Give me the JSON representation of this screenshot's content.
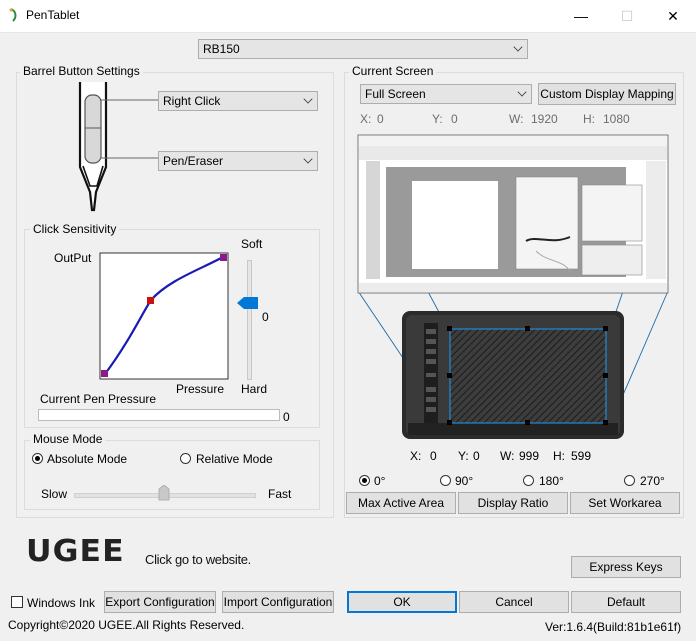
{
  "window": {
    "title": "PenTablet",
    "minimize": "—",
    "maximize": "☐",
    "close": "✕"
  },
  "device": {
    "selected": "RB150"
  },
  "barrel": {
    "group_label": "Barrel Button Settings",
    "upper_value": "Right Click",
    "lower_value": "Pen/Eraser"
  },
  "sensitivity": {
    "group_label": "Click Sensitivity",
    "output_label": "OutPut",
    "pressure_label": "Pressure",
    "soft_label": "Soft",
    "hard_label": "Hard",
    "slider_value": "0",
    "current_pressure_label": "Current Pen Pressure",
    "current_pressure_value": "0"
  },
  "mouse_mode": {
    "group_label": "Mouse Mode",
    "absolute_label": "Absolute Mode",
    "relative_label": "Relative Mode",
    "slow_label": "Slow",
    "fast_label": "Fast",
    "selected": "absolute"
  },
  "screen": {
    "group_label": "Current Screen",
    "selected": "Full Screen",
    "custom_button": "Custom Display Mapping",
    "x_label": "X:",
    "x_value": "0",
    "y_label": "Y:",
    "y_value": "0",
    "w_label": "W:",
    "w_value": "1920",
    "h_label": "H:",
    "h_value": "1080"
  },
  "tablet_area": {
    "x_label": "X:",
    "x_value": "0",
    "y_label": "Y:",
    "y_value": "0",
    "w_label": "W:",
    "w_value": "999",
    "h_label": "H:",
    "h_value": "599"
  },
  "rotation": {
    "options": [
      "0°",
      "90°",
      "180°",
      "270°"
    ],
    "selected": "0°"
  },
  "area_buttons": {
    "max_active": "Max Active Area",
    "display_ratio": "Display Ratio",
    "set_workarea": "Set Workarea"
  },
  "brand": {
    "logo_text": "UGEE",
    "website_text": "Click go to website."
  },
  "footer": {
    "express_keys": "Express Keys",
    "windows_ink": "Windows Ink",
    "export": "Export Configuration",
    "import": "Import Configuration",
    "ok": "OK",
    "cancel": "Cancel",
    "default": "Default",
    "copyright": "Copyright©2020  UGEE.All Rights Reserved.",
    "version": "Ver:1.6.4(Build:81b1e61f)"
  },
  "colors": {
    "accent": "#0078d7",
    "curve": "#1a1ab4",
    "control_point": "#cc1111",
    "selection": "#0078d7"
  }
}
